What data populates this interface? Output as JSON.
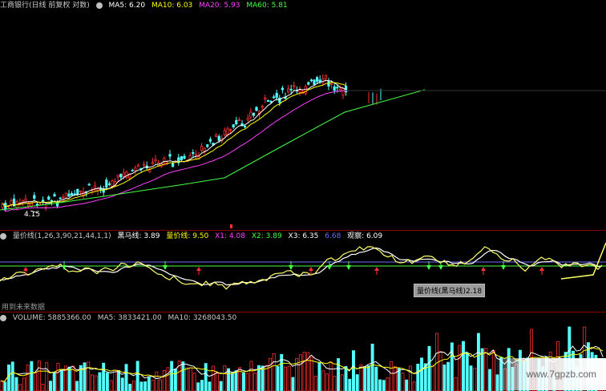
{
  "price_header": {
    "title": "工商银行(日线 前复权 对数)",
    "ma5": "MA5: 6.20",
    "ma10": "MA10: 6.03",
    "ma20": "MA20: 5.93",
    "ma60": "MA60: 5.81"
  },
  "price_annotation": "4.15",
  "indicator_header": {
    "name": "量价线(1,26,3,90,21,44,1,1)",
    "heima": "黑马线: 3.89",
    "liangjia": "量价线: 9.50",
    "x1": "X1: 4.08",
    "x2": "X2: 3.89",
    "x3": "X3: 6.35",
    "x4": "6.68",
    "guancha": "观察: 6.09"
  },
  "tooltip": "量价线(黑马线)2.18",
  "future_note": "用到未来数据",
  "volume_header": {
    "volume": "VOLUME: 5885366.00",
    "ma5": "MA5: 3833421.00",
    "ma10": "MA10: 3268043.50"
  },
  "watermark": "www.7gpzb.com",
  "colors": {
    "up": "#ff3030",
    "down": "#54ffff",
    "ma5": "#ffffff",
    "ma10": "#ffff00",
    "ma20": "#ff40ff",
    "ma60": "#44ff44",
    "indicator_line": "#ffff66",
    "heima_line": "#ffffff"
  },
  "icons": {
    "header_toggle": "circle-toggle-icon",
    "arrow_up": "red-up-arrow-icon",
    "arrow_down": "green-down-arrow-icon"
  }
}
